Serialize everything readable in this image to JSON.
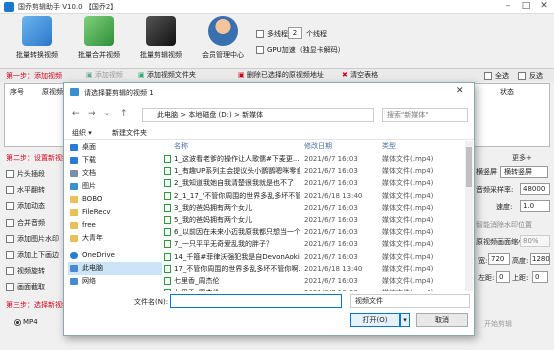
{
  "app": {
    "title": "国乔剪辑助手 V10.0  【国乔2】"
  },
  "toolbar": [
    {
      "label": "批量转换视频",
      "icon": "convert-icon"
    },
    {
      "label": "批量合并视频",
      "icon": "merge-icon"
    },
    {
      "label": "批量剪辑视频",
      "icon": "clapper-icon"
    },
    {
      "label": "会员管理中心",
      "icon": "member-icon"
    }
  ],
  "options": {
    "multithread": "多线程",
    "threads": "2",
    "thread_unit": "个线程",
    "gpu": "GPU加速（独显卡解码）"
  },
  "step1": {
    "label": "第一步：添加视频",
    "add_video": "添加视频",
    "add_folder": "添加视频文件夹",
    "delete_selected": "删除已选择的原视频地址",
    "clear": "清空表格",
    "select_all": "全选",
    "invert": "反选"
  },
  "table": {
    "columns": [
      "序号",
      "原视频",
      "状态"
    ]
  },
  "step2": {
    "label": "第二步：设置新视频",
    "checks": [
      "片头插段",
      "水平翻转",
      "添加动态",
      "合并音频",
      "添加图片水印",
      "添加上下画边",
      "视频旋转",
      "画面截取"
    ],
    "watermark": "智能消除水印位置"
  },
  "right_panel": {
    "more": "更多+",
    "reframe": "横竖屏",
    "reframe_opt": "横转竖屏",
    "sample_rate_label": "音频采样率:",
    "sample_rate": "48000",
    "speed_label": "速度:",
    "speed": "1.0",
    "scale_label": "原视频画面缩小到:",
    "scale": "80%",
    "width_label": "宽:",
    "width": "720",
    "height_label": "高度:",
    "height": "1280",
    "left_label": "左距:",
    "left": "0",
    "right_label": "上距:",
    "right": "0"
  },
  "step3": {
    "label": "第三步：选择新视频",
    "format": "MP4",
    "start": "开始剪辑"
  },
  "dialog": {
    "title": "请选择要剪辑的视频 1",
    "path": [
      "此电脑",
      "本地磁盘 (D:)",
      "新媒体"
    ],
    "search_placeholder": "搜索\"新媒体\"",
    "organize": "组织 ▾",
    "new_folder": "新建文件夹",
    "columns": [
      "名称",
      "修改日期",
      "类型"
    ],
    "tree": [
      {
        "label": "桌面",
        "color": "#2a7bd4"
      },
      {
        "label": "下载",
        "color": "#2a7bd4"
      },
      {
        "label": "文档",
        "color": "#7d8fa8"
      },
      {
        "label": "图片",
        "color": "#3a8fd1"
      },
      {
        "label": "BOBO",
        "color": "#e8c15a"
      },
      {
        "label": "FileRecv",
        "color": "#e8c15a"
      },
      {
        "label": "free",
        "color": "#e8c15a"
      },
      {
        "label": "大青年",
        "color": "#e8c15a"
      },
      {
        "label": "OneDrive",
        "color": "#2a7bd4"
      },
      {
        "label": "此电脑",
        "color": "#4a8ad4"
      },
      {
        "label": "网络",
        "color": "#4a8ad4"
      }
    ],
    "files": [
      {
        "name": "1_这波看老爹的操作让人歌儒#下麦更...",
        "date": "2021/6/7 16:03",
        "type": "媒体文件(.mp4)"
      },
      {
        "name": "1_有趣UP系列主会提议头小鹦鹦嗯咪零食...",
        "date": "2021/6/7 16:03",
        "type": "媒体文件(.mp4)"
      },
      {
        "name": "2_我知道我她自我清楚很我就是也不了",
        "date": "2021/6/7 16:03",
        "type": "媒体文件(.mp4)"
      },
      {
        "name": "2_1_17_'不管你周围的世界多乱多坏不管你...",
        "date": "2021/6/18 13:40",
        "type": "媒体文件(.mp4)"
      },
      {
        "name": "3_我的爸妈拥有两个女儿",
        "date": "2021/6/7 16:03",
        "type": "媒体文件(.mp4)"
      },
      {
        "name": "5_我的爸妈拥有两个女儿",
        "date": "2021/6/7 16:03",
        "type": "媒体文件(.mp4)"
      },
      {
        "name": "6_以前因在未来小迈我原我都只想当一个...",
        "date": "2021/6/7 16:03",
        "type": "媒体文件(.mp4)"
      },
      {
        "name": "7_一只平平无奇爱乱我的胖子？",
        "date": "2021/6/7 16:03",
        "type": "媒体文件(.mp4)"
      },
      {
        "name": "14_千箍#菲律沃强犯我是自DevonAoki#...",
        "date": "2021/6/7 16:03",
        "type": "媒体文件(.mp4)"
      },
      {
        "name": "17_不管你周围的世界多乱多坏不管你啊...",
        "date": "2021/6/18 13:40",
        "type": "媒体文件(.mp4)"
      },
      {
        "name": "七里香_周杰伦",
        "date": "2021/6/7 16:03",
        "type": "媒体文件(.mp4)"
      },
      {
        "name": "七里香_周杰伦",
        "date": "2021/6/7 16:03",
        "type": "媒体文件(.mp4)"
      }
    ],
    "filename_label": "文件名(N):",
    "filetype": "视频文件",
    "open": "打开(O)",
    "cancel": "取消"
  }
}
